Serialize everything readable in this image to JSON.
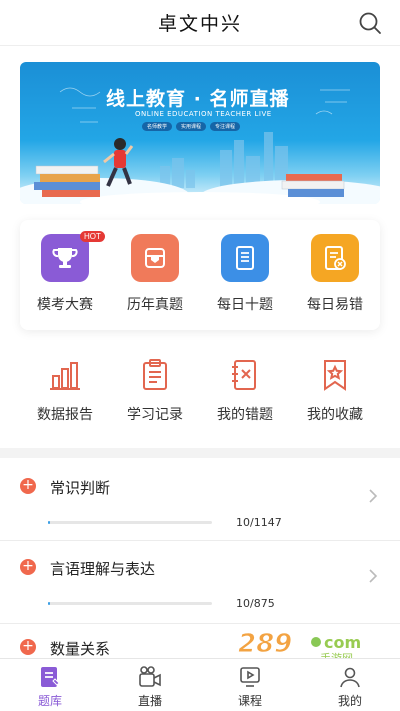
{
  "header": {
    "title": "卓文中兴",
    "search_icon": "search-icon"
  },
  "banner": {
    "headline": "线上教育 · 名师直播",
    "subtitle": "ONLINE EDUCATION TEACHER LIVE",
    "chips": [
      "名师教学",
      "实用课程",
      "专注课程"
    ]
  },
  "features": [
    {
      "label": "模考大赛",
      "icon": "trophy-icon",
      "badge": "HOT",
      "color": "#8a5bd6"
    },
    {
      "label": "历年真题",
      "icon": "bag-icon",
      "color": "#f07a5a"
    },
    {
      "label": "每日十题",
      "icon": "tablet-icon",
      "color": "#3c8fe6"
    },
    {
      "label": "每日易错",
      "icon": "doc-error-icon",
      "color": "#f5a623"
    }
  ],
  "tools": [
    {
      "label": "数据报告",
      "icon": "bar-chart-icon"
    },
    {
      "label": "学习记录",
      "icon": "clipboard-icon"
    },
    {
      "label": "我的错题",
      "icon": "notebook-x-icon"
    },
    {
      "label": "我的收藏",
      "icon": "bookmark-star-icon"
    }
  ],
  "subjects": [
    {
      "name": "常识判断",
      "count": "10/1147",
      "progress": 0.009
    },
    {
      "name": "言语理解与表达",
      "count": "10/875",
      "progress": 0.011
    },
    {
      "name": "数量关系"
    }
  ],
  "tabs": [
    {
      "label": "题库",
      "icon": "question-bank-icon",
      "active": true
    },
    {
      "label": "直播",
      "icon": "video-camera-icon"
    },
    {
      "label": "课程",
      "icon": "course-icon"
    },
    {
      "label": "我的",
      "icon": "profile-icon"
    }
  ],
  "watermark": {
    "text": "289.com",
    "sub": "手游网"
  },
  "colors": {
    "accent": "#8a5bd6",
    "plus": "#f0684d",
    "progress": "#3a9fe6",
    "tool_icon": "#e2664f"
  }
}
